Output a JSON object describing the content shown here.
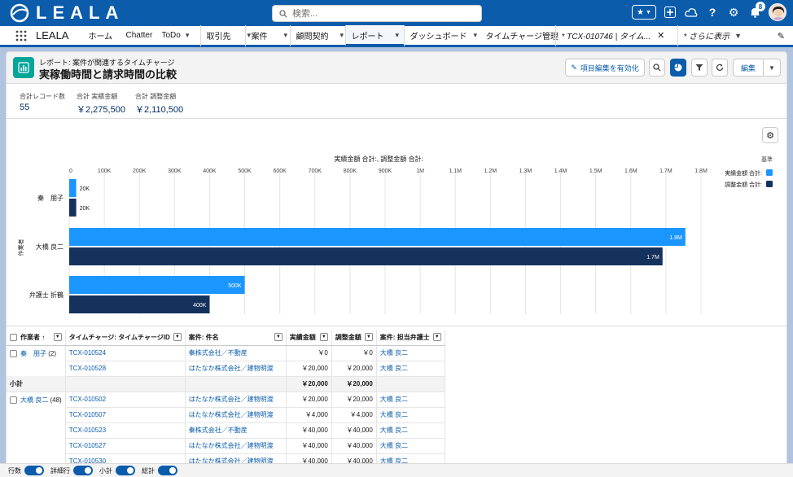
{
  "brand": {
    "logo_text": "LEALA"
  },
  "search": {
    "placeholder": "検索..."
  },
  "notifications": {
    "count": "8"
  },
  "nav": {
    "app_name": "LEALA",
    "items": [
      {
        "label": "ホーム",
        "chevron": false
      },
      {
        "label": "Chatter",
        "chevron": false
      },
      {
        "label": "ToDo",
        "chevron": true
      },
      {
        "label": "取引先",
        "chevron": true
      },
      {
        "label": "案件",
        "chevron": true
      },
      {
        "label": "顧問契約",
        "chevron": true
      },
      {
        "label": "レポート",
        "chevron": true,
        "active": true
      },
      {
        "label": "ダッシュボード",
        "chevron": true
      },
      {
        "label": "タイムチャージ管理",
        "chevron": false
      },
      {
        "label": "* TCX-010746 | タイム...",
        "close": true
      },
      {
        "label": "* さらに表示",
        "chevron": true
      }
    ]
  },
  "report": {
    "subtitle": "レポート: 案件が関連するタイムチャージ",
    "title": "実稼働時間と請求時間の比較",
    "buttons": {
      "edit_columns": "項目編集を有効化",
      "edit": "編集"
    }
  },
  "summary": [
    {
      "label": "合計レコード数",
      "value": "55"
    },
    {
      "label": "合計 実績金額",
      "value": "￥2,275,500"
    },
    {
      "label": "合計 調整金額",
      "value": "￥2,110,500"
    }
  ],
  "chart_data": {
    "type": "bar",
    "orientation": "horizontal",
    "title": "実績金額 合計:, 調整金額 合計:",
    "ylabel": "作業者",
    "legend_title": "基準",
    "legend_position": "right",
    "categories": [
      "秦　朋子",
      "大橋 良二",
      "弁護士 折鶴"
    ],
    "x_ticks": [
      "0",
      "100K",
      "200K",
      "300K",
      "400K",
      "500K",
      "600K",
      "700K",
      "800K",
      "900K",
      "1M",
      "1.1M",
      "1.2M",
      "1.3M",
      "1.4M",
      "1.5M",
      "1.6M",
      "1.7M",
      "1.8M"
    ],
    "xlim": [
      0,
      1800000
    ],
    "series": [
      {
        "name": "実績金額 合計:",
        "color": "#1b96ff",
        "values": [
          20000,
          1755500,
          500000
        ],
        "labels": [
          "20K",
          "1.8M",
          "500K"
        ]
      },
      {
        "name": "調整金額 合計:",
        "color": "#14325c",
        "values": [
          20000,
          1690500,
          400000
        ],
        "labels": [
          "20K",
          "1.7M",
          "400K"
        ]
      }
    ]
  },
  "table": {
    "headers": [
      "作業者 ↑",
      "タイムチャージ: タイムチャージID",
      "案件: 件名",
      "実績金額",
      "調整金額",
      "案件: 担当弁護士"
    ],
    "group1": {
      "name": "秦　朋子",
      "count": "(2)",
      "rows": [
        [
          "TCX-010524",
          "秦株式会社／不動産",
          "￥0",
          "￥0",
          "大橋 良二"
        ],
        [
          "TCX-010528",
          "はたなか株式会社／建物明渡",
          "￥20,000",
          "￥20,000",
          "大橋 良二"
        ]
      ],
      "subtotal_label": "小計",
      "subtotal": [
        "￥20,000",
        "￥20,000"
      ]
    },
    "group2": {
      "name": "大橋 良二",
      "count": "(48)",
      "rows": [
        [
          "TCX-010502",
          "はたなか株式会社／建物明渡",
          "￥20,000",
          "￥20,000",
          "大橋 良二"
        ],
        [
          "TCX-010507",
          "はたなか株式会社／建物明渡",
          "￥4,000",
          "￥4,000",
          "大橋 良二"
        ],
        [
          "TCX-010523",
          "秦株式会社／不動産",
          "￥40,000",
          "￥40,000",
          "大橋 良二"
        ],
        [
          "TCX-010527",
          "はたなか株式会社／建物明渡",
          "￥40,000",
          "￥40,000",
          "大橋 良二"
        ],
        [
          "TCX-010530",
          "はたなか株式会社／建物明渡",
          "￥40,000",
          "￥40,000",
          "大橋 良二"
        ]
      ]
    }
  },
  "footer": {
    "toggles": [
      "行数",
      "詳細行",
      "小計",
      "総計"
    ]
  }
}
